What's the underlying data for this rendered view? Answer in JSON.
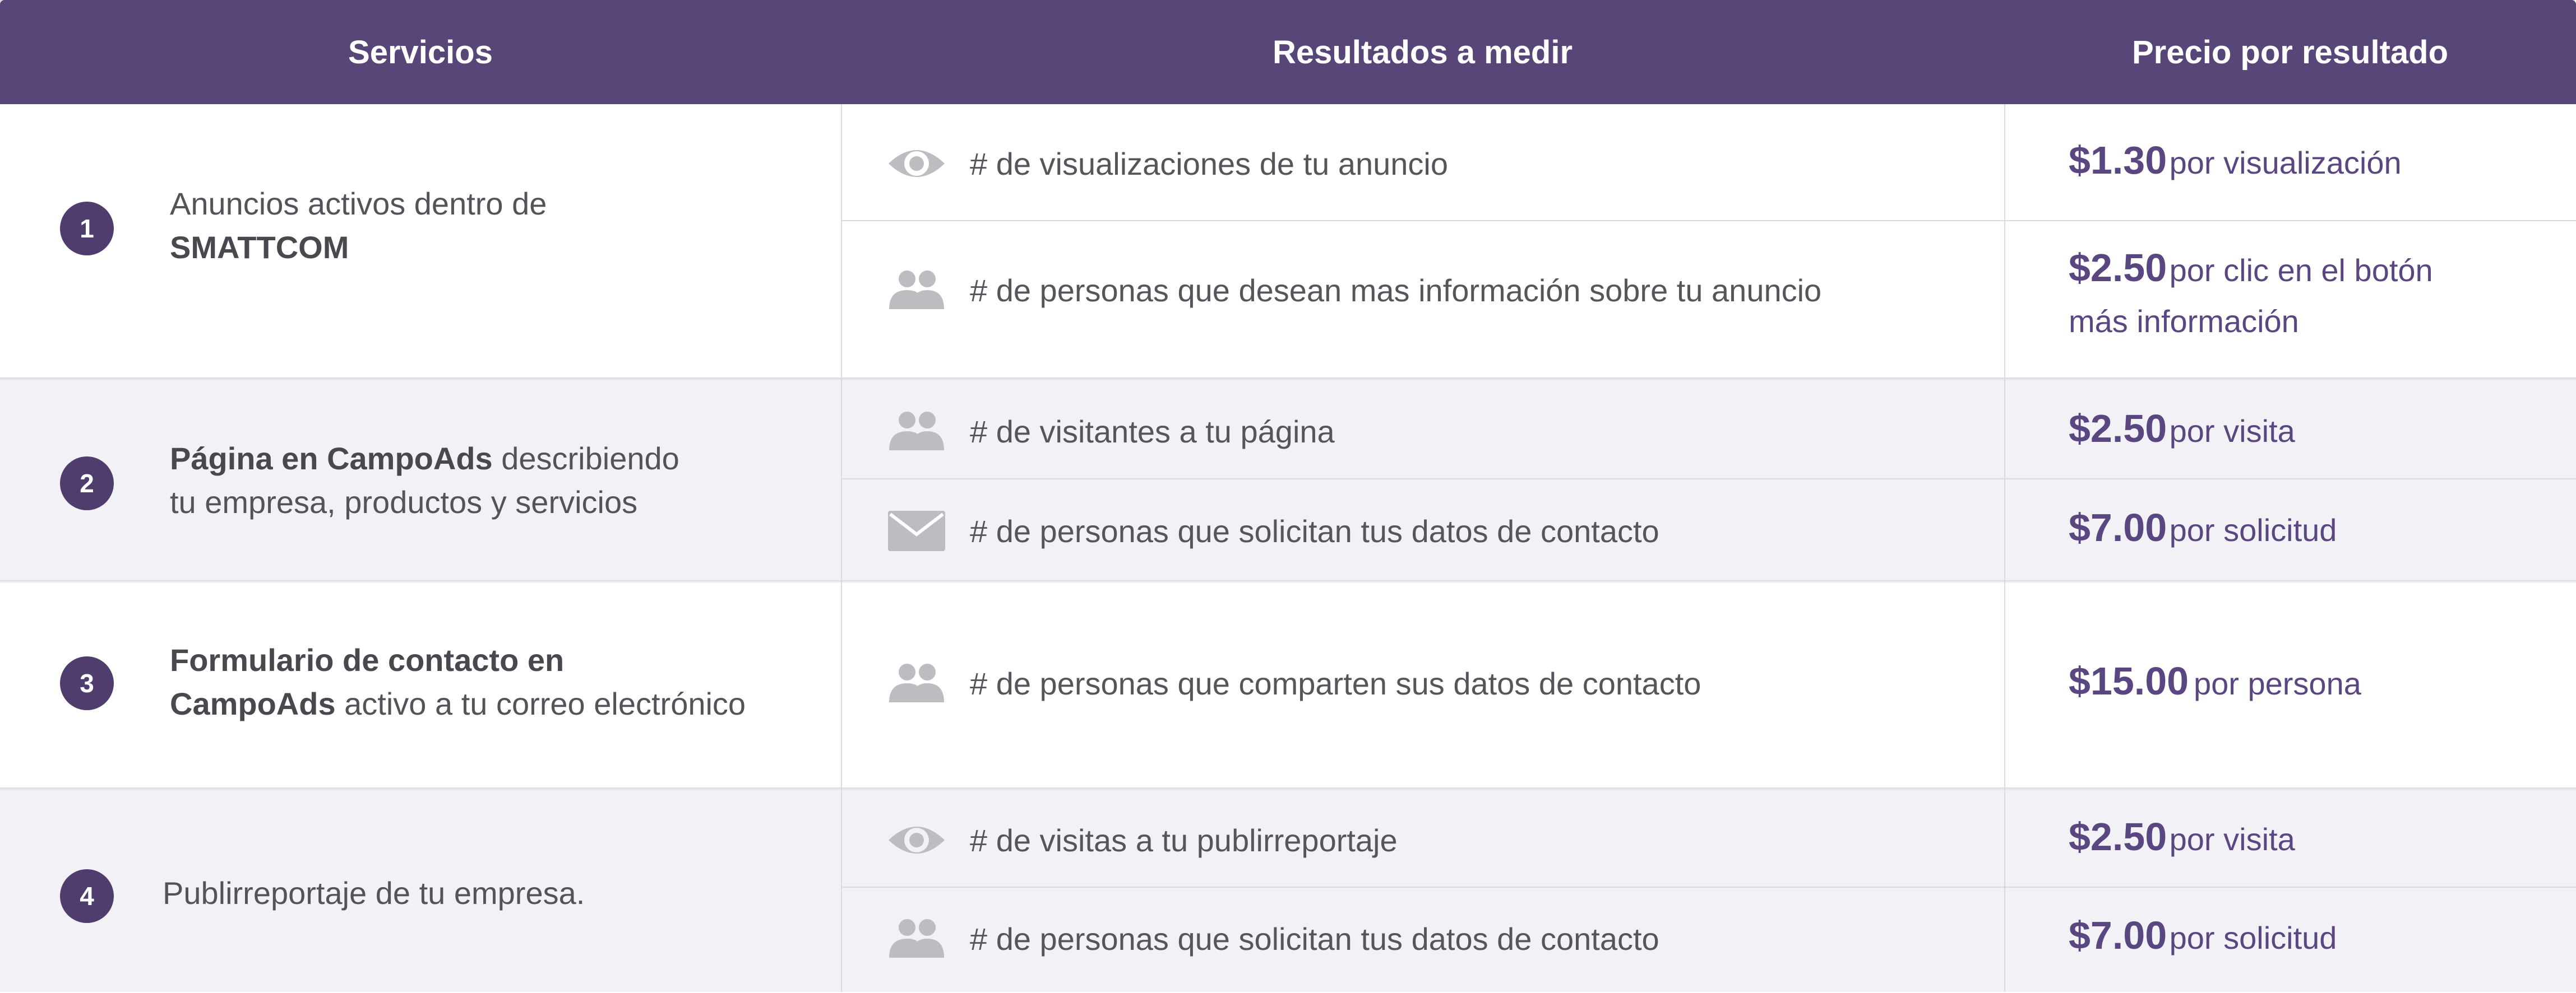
{
  "header": {
    "col1": "Servicios",
    "col2": "Resultados a medir",
    "col3": "Precio por resultado"
  },
  "colors": {
    "header_bg": "#594678",
    "badge_bg": "#4f3e6d",
    "price_text": "#5a4681",
    "shaded_row": "#f2f1f6"
  },
  "services": [
    {
      "number": "1",
      "text_plain_before": "Anuncios activos dentro de",
      "text_bold": "SMATTCOM",
      "results": [
        {
          "icon": "eye-icon",
          "text": "# de visualizaciones de tu anuncio",
          "amount": "$1.30",
          "unit": "por visualización"
        },
        {
          "icon": "people-icon",
          "text": "# de personas que desean mas información sobre tu anuncio",
          "amount": "$2.50",
          "unit": "por clic en el botón",
          "unit_line2": "más información"
        }
      ]
    },
    {
      "number": "2",
      "text_bold": "Página en CampoAds",
      "text_plain_after": "describiendo",
      "text_line2": "tu empresa, productos y servicios",
      "results": [
        {
          "icon": "people-icon",
          "text": "# de visitantes a tu página",
          "amount": "$2.50",
          "unit": "por visita"
        },
        {
          "icon": "envelope-icon",
          "text": "# de personas que solicitan tus datos de contacto",
          "amount": "$7.00",
          "unit": "por solicitud"
        }
      ]
    },
    {
      "number": "3",
      "text_bold": "Formulario de contacto en",
      "text_bold_line2": "CampoAds",
      "text_plain_line2": "activo a tu correo electrónico",
      "results": [
        {
          "icon": "people-icon",
          "text": "# de personas que comparten sus datos de contacto",
          "amount": "$15.00",
          "unit": "por persona"
        }
      ]
    },
    {
      "number": "4",
      "text_plain": "Publirreportaje de tu empresa.",
      "results": [
        {
          "icon": "eye-icon",
          "text": "# de visitas a tu publirreportaje",
          "amount": "$2.50",
          "unit": "por visita"
        },
        {
          "icon": "people-icon",
          "text": "# de personas que solicitan tus datos de contacto",
          "amount": "$7.00",
          "unit": "por solicitud"
        }
      ]
    }
  ]
}
